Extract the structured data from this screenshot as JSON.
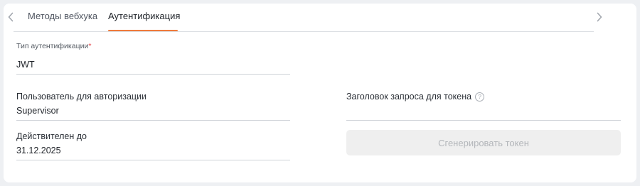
{
  "tabs": {
    "items": [
      {
        "label": "Методы вебхука",
        "active": false
      },
      {
        "label": "Аутентификация",
        "active": true
      }
    ],
    "prev_icon": "chevron-left-icon",
    "next_icon": "chevron-right-icon",
    "accent_color": "#ef7b3c"
  },
  "form": {
    "auth_type": {
      "label": "Тип аутентификации",
      "required_mark": "*",
      "value": "JWT"
    },
    "user": {
      "label": "Пользователь для авторизации",
      "value": "Supervisor"
    },
    "valid_until": {
      "label": "Действителен до",
      "value": "31.12.2025"
    },
    "token_header": {
      "label": "Заголовок запроса для токена",
      "help_icon": "question-circle-icon",
      "help_glyph": "?",
      "value": ""
    },
    "generate_button": {
      "label": "Сгенерировать токен",
      "disabled": true
    }
  }
}
